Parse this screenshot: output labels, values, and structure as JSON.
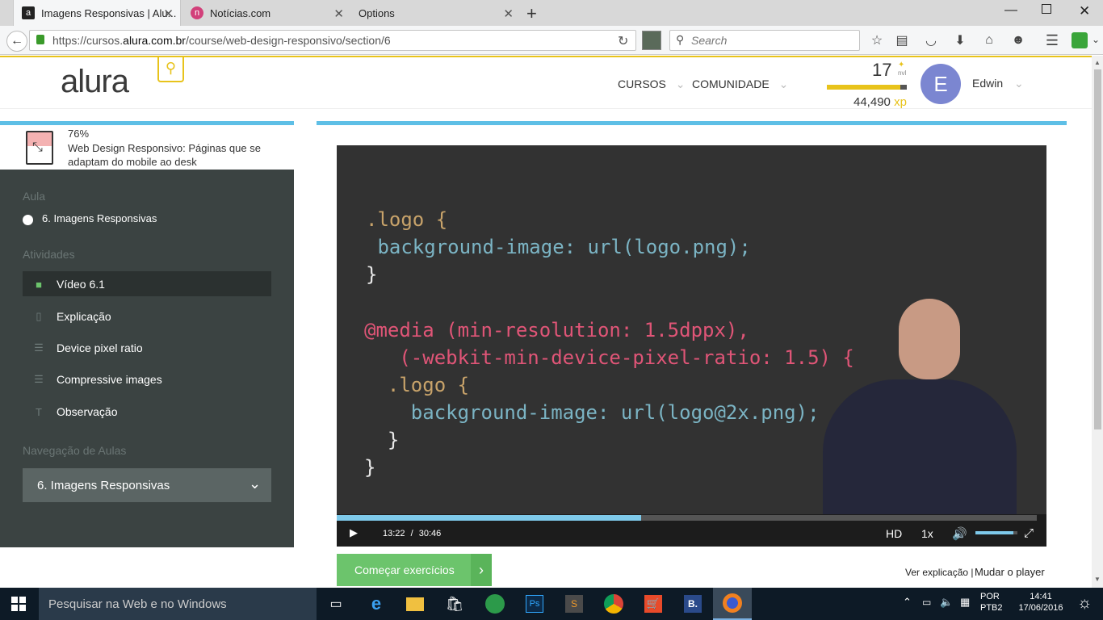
{
  "browser": {
    "tabs": [
      {
        "label": "Imagens Responsivas | Alu...",
        "active": true
      },
      {
        "label": "Notícias.com",
        "active": false
      },
      {
        "label": "Options",
        "active": false
      }
    ],
    "url_prefix": "https://cursos.",
    "url_domain": "alura.com.br",
    "url_path": "/course/web-design-responsivo/section/6",
    "search_placeholder": "Search"
  },
  "site": {
    "logo": "alura",
    "nav": {
      "cursos": "CURSOS",
      "comunidade": "COMUNIDADE"
    },
    "level": "17",
    "level_label": "nvl",
    "xp_value": "44,490",
    "xp_label": "xp",
    "xp_progress": 0.92,
    "avatar_letter": "E",
    "user_name": "Edwin"
  },
  "course": {
    "progress": "76%",
    "title_line1": "Web Design Responsivo: Páginas que se",
    "title_line2": "adaptam do mobile ao desk"
  },
  "sidebar": {
    "aula_heading": "Aula",
    "aula_item": "6. Imagens Responsivas",
    "atividades_heading": "Atividades",
    "activities": [
      {
        "label": "Vídeo 6.1",
        "icon": "video-camera-icon",
        "active": true
      },
      {
        "label": "Explicação",
        "icon": "document-icon",
        "active": false
      },
      {
        "label": "Device pixel ratio",
        "icon": "list-icon",
        "active": false
      },
      {
        "label": "Compressive images",
        "icon": "list-icon",
        "active": false
      },
      {
        "label": "Observação",
        "icon": "text-icon",
        "active": false
      }
    ],
    "nav_heading": "Navegação de Aulas",
    "nav_select": "6. Imagens Responsivas"
  },
  "video": {
    "code": [
      ".logo {",
      " background-image: url(logo.png);",
      "}",
      "@media (min-resolution: 1.5dppx),",
      "   (-webkit-min-device-pixel-ratio: 1.5) {",
      "  .logo {",
      "    background-image: url(logo@2x.png);",
      "  }",
      "}"
    ],
    "current_time": "13:22",
    "separator": "/",
    "total_time": "30:46",
    "played_fraction": 0.4346,
    "quality": "HD",
    "speed": "1x",
    "volume_fraction": 0.9
  },
  "actions": {
    "start_exercises": "Começar exercícios",
    "see_explanation": "Ver explicação",
    "separator": "|",
    "change_player": "Mudar o player"
  },
  "taskbar": {
    "search_placeholder": "Pesquisar na Web e no Windows",
    "lang_top": "POR",
    "lang_bottom": "PTB2",
    "time": "14:41",
    "date": "17/06/2016"
  },
  "colors": {
    "accent_blue": "#5ebfe6",
    "sidebar_bg": "#3b4342",
    "green_button": "#6cc46c",
    "xp_yellow": "#e8c31b",
    "avatar": "#7b86d1"
  }
}
